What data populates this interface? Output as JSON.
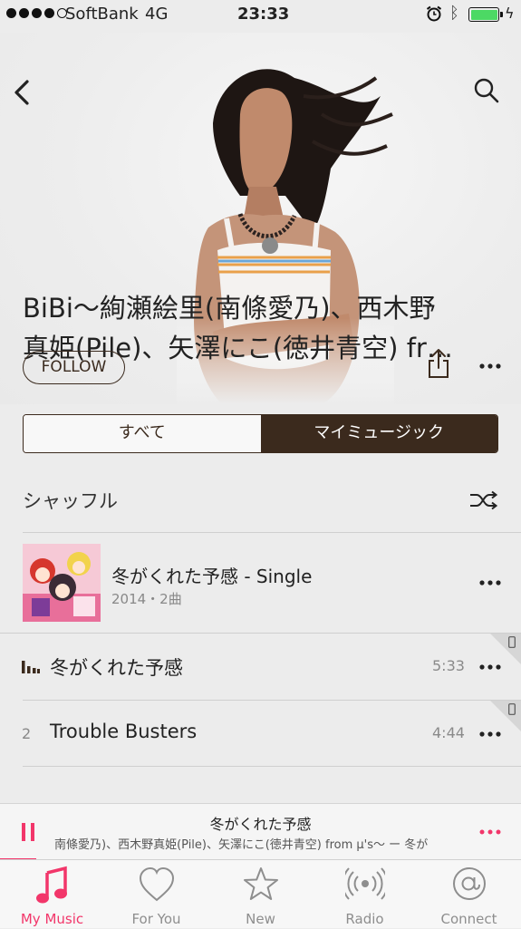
{
  "status_bar": {
    "carrier": "SoftBank",
    "network": "4G",
    "time": "23:33",
    "battery_level": 1.0,
    "colors": {
      "battery": "#4cd964"
    }
  },
  "header": {
    "back_icon": "chevron-left-icon",
    "search_icon": "search-icon"
  },
  "artist": {
    "name_line1": "BiBi〜絢瀬絵里(南條愛乃)、西木野",
    "name_line2": "真姫(Pile)、矢澤にこ(徳井青空) fr…",
    "follow_label": "FOLLOW"
  },
  "segmented": {
    "all_label": "すべて",
    "my_music_label": "マイミュージック",
    "selected": "マイミュージック"
  },
  "shuffle": {
    "label": "シャッフル"
  },
  "album": {
    "title": "冬がくれた予感 - Single",
    "meta": "2014・2曲"
  },
  "tracks": [
    {
      "number": "",
      "title": "冬がくれた予感",
      "duration": "5:33",
      "playing": true
    },
    {
      "number": "2",
      "title": "Trouble Busters",
      "duration": "4:44",
      "playing": false
    }
  ],
  "now_playing": {
    "title": "冬がくれた予感",
    "subtitle": "南條愛乃)、西木野真姫(Pile)、矢澤にこ(徳井青空)  from μ's〜 ー 冬が"
  },
  "tabs": [
    {
      "label": "My Music",
      "icon": "music-note-icon",
      "active": true
    },
    {
      "label": "For You",
      "icon": "heart-icon",
      "active": false
    },
    {
      "label": "New",
      "icon": "star-icon",
      "active": false
    },
    {
      "label": "Radio",
      "icon": "radio-waves-icon",
      "active": false
    },
    {
      "label": "Connect",
      "icon": "at-sign-icon",
      "active": false
    }
  ],
  "colors": {
    "accent": "#f2366a",
    "segment_dark": "#3b2a1d"
  }
}
